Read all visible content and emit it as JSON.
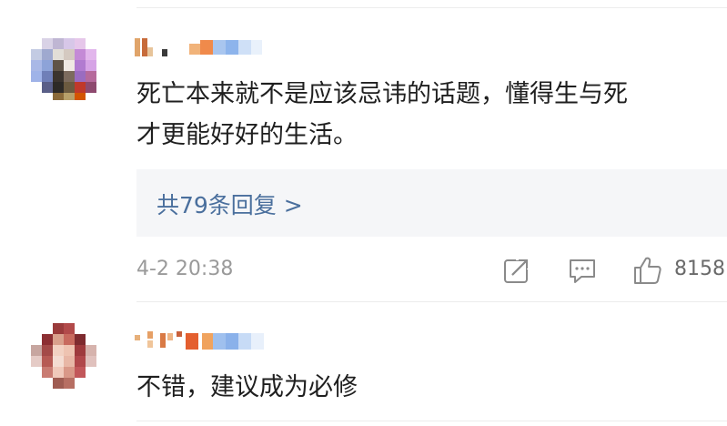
{
  "comments": [
    {
      "text_lines": [
        "死亡本来就不是应该忌讳的话题，懂得生与死",
        "才更能好好的生活。"
      ],
      "replies_label": "共79条回复 >",
      "timestamp": "4-2 20:38",
      "like_count": "8158"
    },
    {
      "text_lines": [
        "不错，建议成为必修"
      ]
    }
  ],
  "icons": [
    "share-icon",
    "comment-icon",
    "like-icon"
  ],
  "colors": {
    "text": "#1f1f1f",
    "meta": "#9a9a9a",
    "link": "#4a6f9d",
    "reply_box_bg": "#f5f6f8",
    "divider": "#ececec"
  }
}
